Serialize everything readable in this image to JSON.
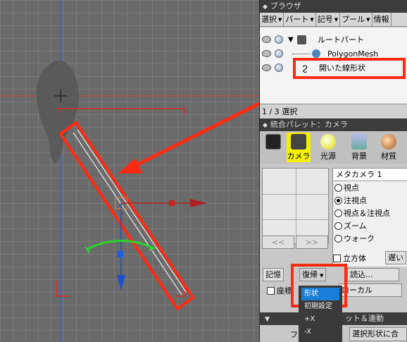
{
  "browser": {
    "title": "ブラウザ",
    "tabs": [
      "選択",
      "パート",
      "記号",
      "プール",
      "情報"
    ],
    "tree": [
      {
        "label": "ルートパート"
      },
      {
        "label": "PolygonMesh"
      },
      {
        "label": "開いた線形状"
      }
    ],
    "status": "1 / 3 選択"
  },
  "palette": {
    "title": "統合パレット：カメラ",
    "tools": [
      "カメラ",
      "光源",
      "背景",
      "材質"
    ],
    "camera_name": "メタカメラ 1",
    "options": [
      "視点",
      "注視点",
      "視点＆注視点",
      "ズーム",
      "ウォーク"
    ],
    "selected_option": "注視点",
    "nav_prev": "<<",
    "nav_next": ">>",
    "cube_label": "立方体",
    "far_button": "遅い",
    "memory_button": "記憶",
    "restore_button": "復帰",
    "load_button": "読込...",
    "coords_label": "座標",
    "local_label": "ローカル",
    "section_label": "ット＆連動",
    "fit_button": "選択形状に合",
    "fit_prefix": "フ"
  },
  "restore_menu": {
    "items": [
      "形状",
      "初期設定",
      "+X",
      "-X"
    ],
    "selected": "形状"
  },
  "colors": {
    "highlight": "#ff2a12",
    "menu_select": "#1a7fd8"
  }
}
